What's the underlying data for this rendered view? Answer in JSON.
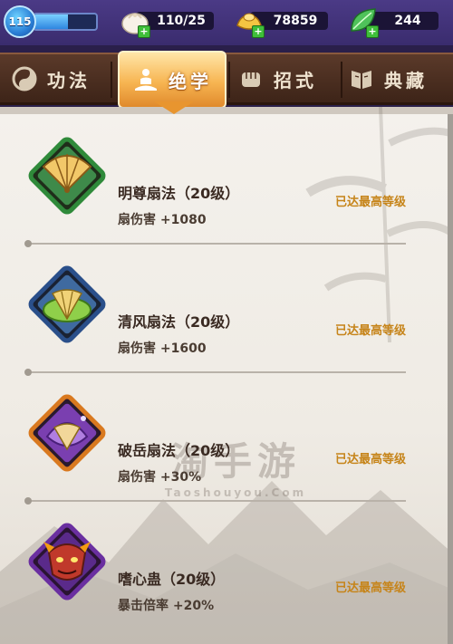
{
  "player": {
    "level": "115",
    "xp_fraction": 0.55
  },
  "resources": [
    {
      "icon": "steamed-bun-icon",
      "value": "110/25"
    },
    {
      "icon": "gold-ingot-icon",
      "value": "78859"
    },
    {
      "icon": "jade-leaf-icon",
      "value": "244"
    }
  ],
  "tabs": [
    {
      "label": "功法",
      "icon": "gongfa-icon",
      "active": false
    },
    {
      "label": "绝学",
      "icon": "meditation-icon",
      "active": true
    },
    {
      "label": "招式",
      "icon": "fist-icon",
      "active": false
    },
    {
      "label": "典藏",
      "icon": "book-icon",
      "active": false
    }
  ],
  "skills": [
    {
      "name": "明尊扇法（20级）",
      "effect": "扇伤害 +1080",
      "status": "已达最高等级",
      "icon": "golden-fan-icon",
      "frame_color": "#2f8a3a"
    },
    {
      "name": "清风扇法（20级）",
      "effect": "扇伤害 +1600",
      "status": "已达最高等级",
      "icon": "leaf-fan-icon",
      "frame_color": "#2a4f8a"
    },
    {
      "name": "破岳扇法（20级）",
      "effect": "扇伤害 +30%",
      "status": "已达最高等级",
      "icon": "purple-fan-icon",
      "frame_color": "#d9791f"
    },
    {
      "name": "嗜心蛊（20级）",
      "effect": "暴击倍率 +20%",
      "status": "已达最高等级",
      "icon": "demon-mask-icon",
      "frame_color": "#6a2fa0"
    }
  ],
  "watermark": {
    "main": "淘手游",
    "sub": "Taoshouyou.Com"
  }
}
